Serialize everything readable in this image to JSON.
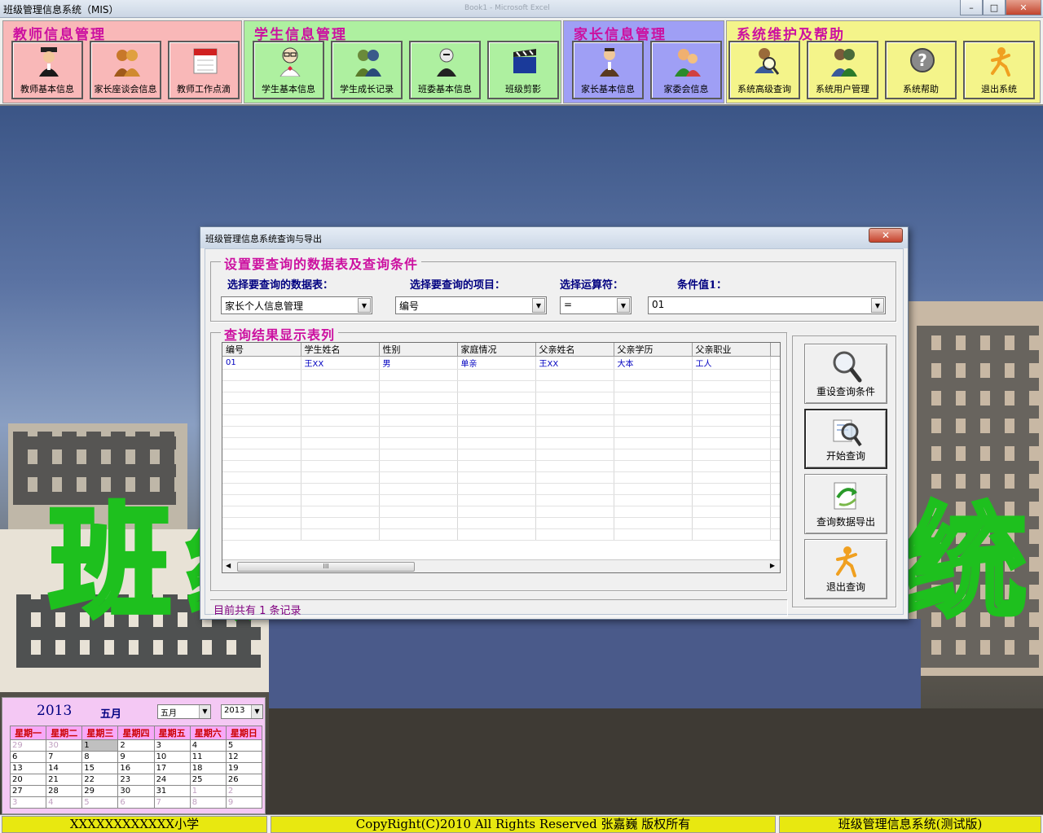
{
  "window": {
    "title": "班级管理信息系统（MIS）",
    "ghost_text": "Book1 - Microsoft Excel",
    "min": "–",
    "max": "□",
    "close": "✕"
  },
  "toolbar": {
    "groups": [
      {
        "title": "教师信息管理",
        "color": "#f9b8b8",
        "buttons": [
          {
            "label": "教师基本信息",
            "icon": "graduate-icon"
          },
          {
            "label": "家长座谈会信息",
            "icon": "meeting-icon"
          },
          {
            "label": "教师工作点滴",
            "icon": "calendar-icon"
          }
        ]
      },
      {
        "title": "学生信息管理",
        "color": "#aef0a0",
        "buttons": [
          {
            "label": "学生基本信息",
            "icon": "student-icon"
          },
          {
            "label": "学生成长记录",
            "icon": "growth-icon"
          },
          {
            "label": "班委基本信息",
            "icon": "committee-icon"
          },
          {
            "label": "班级剪影",
            "icon": "clapperboard-icon"
          }
        ]
      },
      {
        "title": "家长信息管理",
        "color": "#9f9ff5",
        "buttons": [
          {
            "label": "家长基本信息",
            "icon": "parent-icon"
          },
          {
            "label": "家委会信息",
            "icon": "family-icon"
          }
        ]
      },
      {
        "title": "系统维护及帮助",
        "color": "#f4f48a",
        "buttons": [
          {
            "label": "系统高级查询",
            "icon": "search-user-icon"
          },
          {
            "label": "系统用户管理",
            "icon": "users-icon"
          },
          {
            "label": "系统帮助",
            "icon": "help-icon"
          },
          {
            "label": "退出系统",
            "icon": "exit-icon"
          }
        ]
      }
    ]
  },
  "background": {
    "watermark_left": "班级",
    "watermark_right": "统"
  },
  "calendar": {
    "year": "2013",
    "month": "五月",
    "month_select": "五月",
    "year_select": "2013",
    "weekdays": [
      "星期一",
      "星期二",
      "星期三",
      "星期四",
      "星期五",
      "星期六",
      "星期日"
    ],
    "weeks": [
      [
        "29",
        "30",
        "1",
        "2",
        "3",
        "4",
        "5"
      ],
      [
        "6",
        "7",
        "8",
        "9",
        "10",
        "11",
        "12"
      ],
      [
        "13",
        "14",
        "15",
        "16",
        "17",
        "18",
        "19"
      ],
      [
        "20",
        "21",
        "22",
        "23",
        "24",
        "25",
        "26"
      ],
      [
        "27",
        "28",
        "29",
        "30",
        "31",
        "1",
        "2"
      ],
      [
        "3",
        "4",
        "5",
        "6",
        "7",
        "8",
        "9"
      ]
    ],
    "selected": "1"
  },
  "statusbar": {
    "school": "XXXXXXXXXXXX小学",
    "copyright": "CopyRight(C)2010  All Rights Reserved 张嘉巍  版权所有",
    "system": "班级管理信息系统(测试版)"
  },
  "dialog": {
    "title": "班级管理信息系统查询与导出",
    "close": "✕",
    "query_section": "设置要查询的数据表及查询条件",
    "labels": {
      "table": "选择要查询的数据表：",
      "field": "选择要查询的项目：",
      "operator": "选择运算符：",
      "value": "条件值1："
    },
    "values": {
      "table": "家长个人信息管理",
      "field": "编号",
      "operator": "=",
      "value": "01"
    },
    "result_section": "查询结果显示表列",
    "columns": [
      "编号",
      "学生姓名",
      "性别",
      "家庭情况",
      "父亲姓名",
      "父亲学历",
      "父亲职业"
    ],
    "rows": [
      [
        "01",
        "王XX",
        "男",
        "单亲",
        "王XX",
        "大本",
        "工人"
      ]
    ],
    "scroll_thumb": "III",
    "record_count": "目前共有 1 条记录",
    "buttons": [
      {
        "label": "重设查询条件",
        "icon": "magnifier-icon"
      },
      {
        "label": "开始查询",
        "icon": "search-query-icon"
      },
      {
        "label": "查询数据导出",
        "icon": "export-icon"
      },
      {
        "label": "退出查询",
        "icon": "exit-icon"
      }
    ]
  }
}
